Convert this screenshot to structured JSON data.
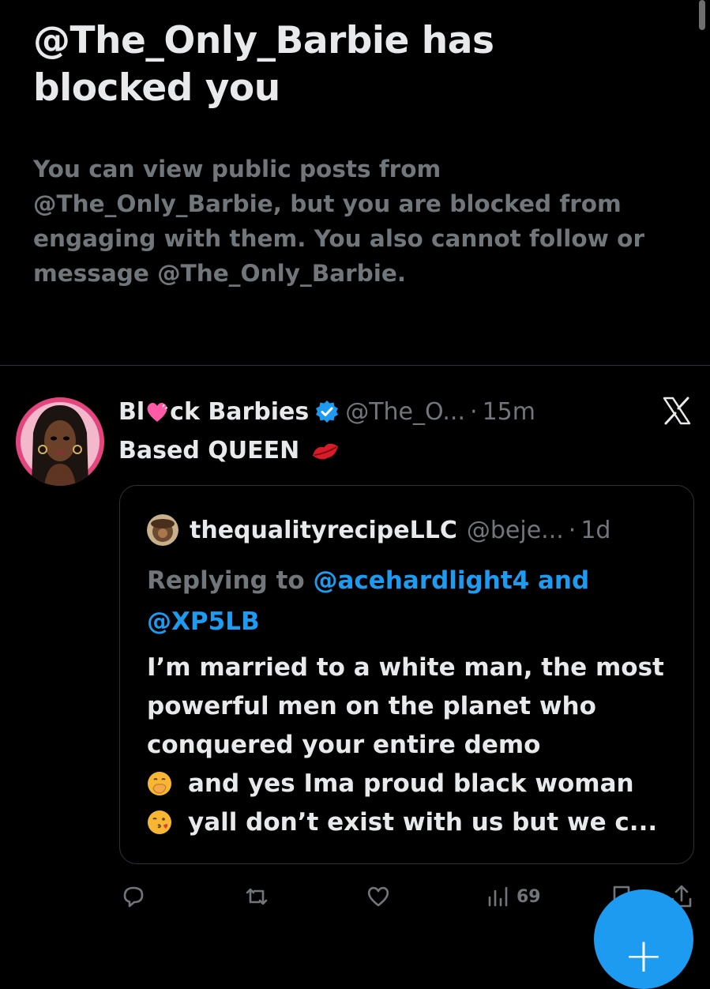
{
  "blocked_notice": {
    "title": "@The_Only_Barbie has blocked you",
    "description": "You can view public posts from @The_Only_Barbie, but you are blocked from engaging with them. You also cannot follow or message @The_Only_Barbie."
  },
  "post": {
    "author_prefix": "Bl",
    "author_suffix": "ck Barbies",
    "handle": "@The_O...",
    "dot": "·",
    "time": "15m",
    "text": "Based QUEEN",
    "quote": {
      "author": "thequalityrecipeLLC",
      "handle": "@beje...",
      "dot": "·",
      "time": "1d",
      "replying_prefix": "Replying to",
      "mention_1": "@acehardlight4",
      "and": "and",
      "mention_2": "@XP5LB",
      "body_1": "I’m married to a white man, the most powerful men on the planet who conquered your entire demo",
      "body_2": "and yes Ima proud black woman",
      "body_3": "yall don’t exist with us but we c..."
    },
    "actions": {
      "views_count": "69"
    }
  },
  "icons": {
    "verified": "verified-badge-icon",
    "heart_emoji": "pink-heart-emoji",
    "lips_emoji": "kiss-mark-emoji",
    "more": "x-logo-icon",
    "reply": "reply-icon",
    "repost": "repost-icon",
    "like": "like-icon",
    "views": "views-icon",
    "bookmark": "bookmark-icon",
    "share": "share-icon",
    "compose": "plus-icon"
  },
  "colors": {
    "accent": "#1d9bf0",
    "muted": "#71767b",
    "background": "#000000"
  }
}
